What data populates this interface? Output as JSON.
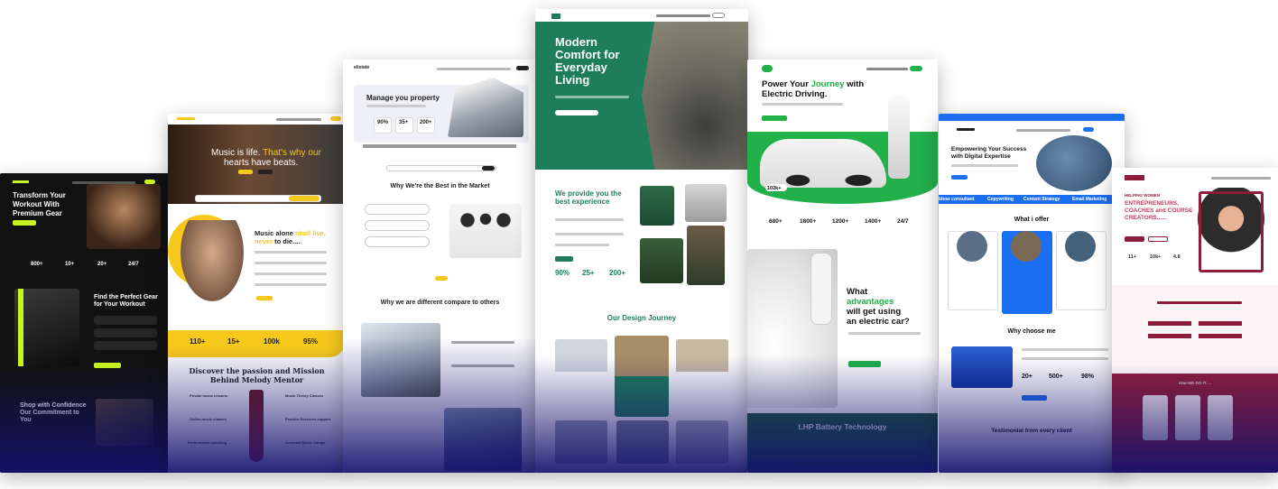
{
  "cards": {
    "gym": {
      "hero": "Transform Your Workout With Premium Gear",
      "stats": [
        "800+",
        "10+",
        "20+",
        "24/7"
      ],
      "section2": "Find the Perfect Gear for Your Workout",
      "section3": "Shop with Confidence Our Commitment to You",
      "accent": "#c9f31d"
    },
    "music": {
      "hero": "Music is life. That's why our hearts have beats.",
      "hero_a": "Music is life. ",
      "hero_b": "That's why our",
      "hero_c": "hearts have beats.",
      "section": "Music alone shall live, never to die....",
      "sec_a": "Music alone ",
      "sec_b": "shall live,",
      "sec_c": "never",
      "sec_d": " to die....",
      "stats": [
        "110+",
        "15+",
        "100k",
        "95%"
      ],
      "bottom_a": "Discover the passion and Mission",
      "bottom_b": "Behind Melody Mentor",
      "features": [
        "Private music lessons",
        "Music Theory Classes",
        "Online music classes",
        "Practice Sessions support",
        "Performance coaching",
        "Seasonal Music Camps"
      ],
      "accent": "#f6c81c"
    },
    "realestate": {
      "logo": "elixtate",
      "hero": "Manage you property",
      "stats": [
        "90%",
        "35+",
        "200+"
      ],
      "section": "Why We're the Best in the Market",
      "section2": "Why we are different compare to others"
    },
    "interior": {
      "hero": "Modern Comfort for Everyday Living",
      "hero_lines": [
        "Modern",
        "Comfort for",
        "Everyday",
        "Living"
      ],
      "section": "We provide you the best experience",
      "sec_lines": [
        "We provide you the",
        "best experience"
      ],
      "stats": [
        "90%",
        "25+",
        "200+"
      ],
      "journey": "Our Design Journey",
      "accent": "#1e7d5a"
    },
    "ev": {
      "hero": "Power Your Journey with Electric Driving.",
      "hero_a": "Power Your ",
      "hero_b": "Journey",
      "hero_c": " with",
      "hero_d": "Electric Driving.",
      "badge": "102k+",
      "stats": [
        "680+",
        "1800+",
        "1200+",
        "1400+",
        "24/7"
      ],
      "section_lines": [
        "What",
        "advantages",
        "will get using",
        "an electric car?"
      ],
      "bottom": "LHP Battery Technology",
      "accent": "#22b04b"
    },
    "marketing": {
      "hero": "Empowering Your Success with Digital Expertise",
      "hero_lines": [
        "Empowering Your Success",
        "with Digital Expertise"
      ],
      "ticker": [
        "Ideas consultant",
        "Copywriting",
        "Content Strategy",
        "Email Marketing",
        "Se"
      ],
      "offer": "What i offer",
      "why": "Why choose me",
      "stats": [
        "20+",
        "500+",
        "98%"
      ],
      "testimonial": "Testimonial from every client",
      "accent": "#1d6ff2"
    },
    "coach": {
      "hero_top": "HELPING WOMEN",
      "hero_lines": [
        "ENTREPRENEURS,",
        "COACHES and COURSE",
        "CREATORS......"
      ],
      "stats": [
        "11+",
        "10k+",
        "4.8"
      ],
      "bottom": "How WE DO IT.....",
      "accent": "#8c1d3a"
    }
  }
}
